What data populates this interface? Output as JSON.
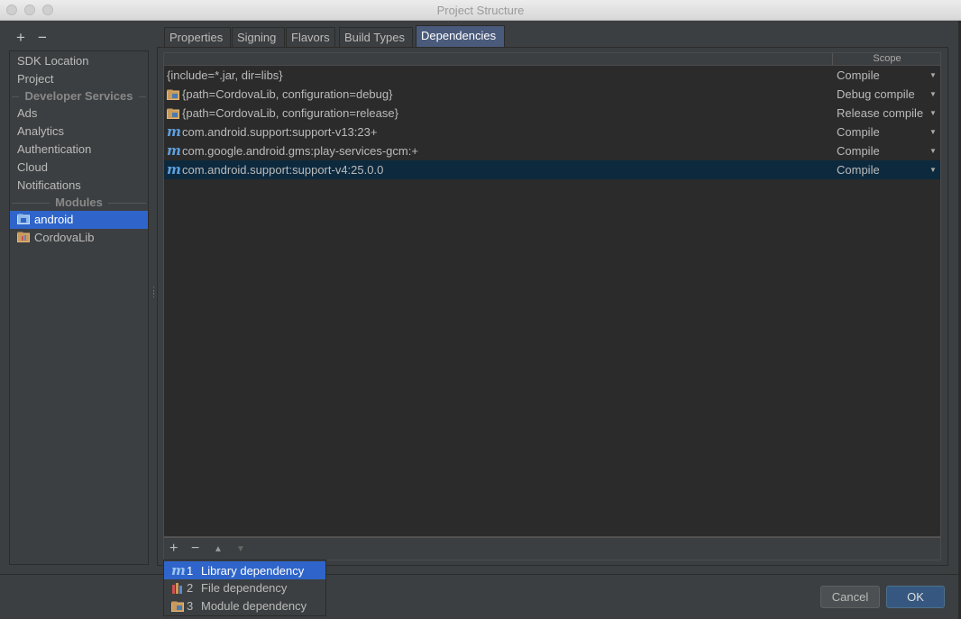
{
  "window": {
    "title": "Project Structure"
  },
  "sidebar": {
    "add_label": "+",
    "remove_label": "−",
    "top_items": [
      "SDK Location",
      "Project"
    ],
    "developer_services_header": "Developer Services",
    "service_items": [
      "Ads",
      "Analytics",
      "Authentication",
      "Cloud",
      "Notifications"
    ],
    "modules_header": "Modules",
    "modules": [
      "android",
      "CordovaLib"
    ],
    "selected_module": "android"
  },
  "tabs": [
    "Properties",
    "Signing",
    "Flavors",
    "Build Types",
    "Dependencies"
  ],
  "active_tab": "Dependencies",
  "table": {
    "scope_header": "Scope",
    "rows": [
      {
        "icon": "none",
        "dependency": "{include=*.jar, dir=libs}",
        "scope": "Compile"
      },
      {
        "icon": "module-folder-icon",
        "dependency": "{path=CordovaLib, configuration=debug}",
        "scope": "Debug compile"
      },
      {
        "icon": "module-folder-icon",
        "dependency": "{path=CordovaLib, configuration=release}",
        "scope": "Release compile"
      },
      {
        "icon": "maven-icon",
        "dependency": "com.android.support:support-v13:23+",
        "scope": "Compile"
      },
      {
        "icon": "maven-icon",
        "dependency": "com.google.android.gms:play-services-gcm:+",
        "scope": "Compile"
      },
      {
        "icon": "maven-icon",
        "dependency": "com.android.support:support-v4:25.0.0",
        "scope": "Compile",
        "selected": true
      }
    ]
  },
  "table_toolbar": {
    "add": "+",
    "remove": "−",
    "move_up": "▲",
    "move_down": "▼"
  },
  "add_popup": [
    {
      "number": "1",
      "label": "Library dependency",
      "icon": "maven-icon"
    },
    {
      "number": "2",
      "label": "File dependency",
      "icon": "jar-file-icon"
    },
    {
      "number": "3",
      "label": "Module dependency",
      "icon": "module-folder-icon"
    }
  ],
  "buttons": {
    "cancel": "Cancel",
    "ok": "OK"
  },
  "colors": {
    "selection_blue": "#2f65ca",
    "row_selected": "#0d293e",
    "active_tab": "#4a5a7a",
    "maven_icon": "#5ea0dd"
  }
}
